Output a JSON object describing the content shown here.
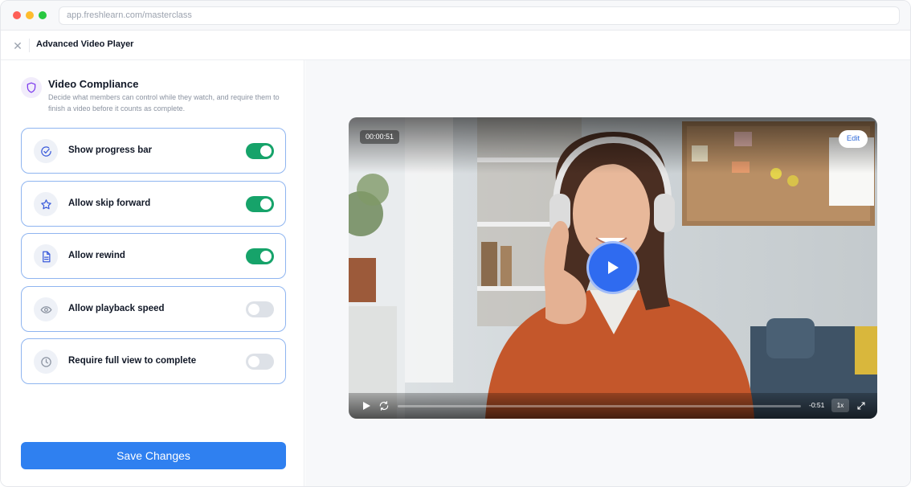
{
  "browser": {
    "url": "app.freshlearn.com/masterclass"
  },
  "header": {
    "close_icon": "close-icon",
    "title": "Advanced Video Player"
  },
  "section": {
    "icon": "shield-icon",
    "title": "Video Compliance",
    "description": "Decide what members can control while they watch, and require them to finish a video before it counts as complete."
  },
  "settings": [
    {
      "label": "Show progress bar",
      "icon": "check-circle-icon",
      "enabled": true
    },
    {
      "label": "Allow skip forward",
      "icon": "star-icon",
      "enabled": true
    },
    {
      "label": "Allow rewind",
      "icon": "document-icon",
      "enabled": true
    },
    {
      "label": "Allow playback speed",
      "icon": "eye-icon",
      "enabled": false
    },
    {
      "label": "Require full view to complete",
      "icon": "clock-icon",
      "enabled": false
    }
  ],
  "save_label": "Save Changes",
  "video": {
    "timestamp": "00:00:51",
    "edit_label": "Edit",
    "time_remaining": "-0:51",
    "speed": "1x",
    "progress": 0
  },
  "colors": {
    "accent": "#2f80f0",
    "toggle_on": "#16a36a",
    "toggle_off": "#dde1e7",
    "card_border": "#8fb5f0",
    "play_button": "#2f6bf0"
  }
}
